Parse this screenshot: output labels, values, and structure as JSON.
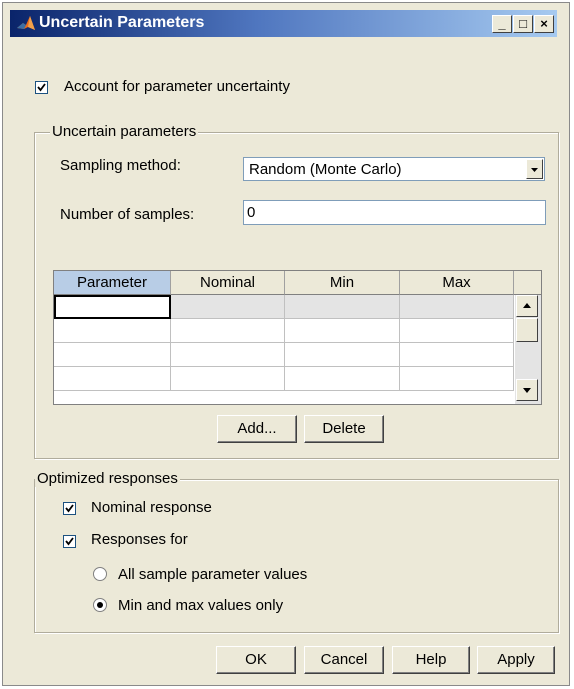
{
  "window": {
    "title": "Uncertain Parameters",
    "controls": {
      "minimize": "_",
      "maximize": "□",
      "close": "×"
    }
  },
  "account_uncertainty": {
    "label": "Account for parameter uncertainty",
    "checked": true
  },
  "uncertain_group": {
    "title": "Uncertain parameters",
    "sampling_label": "Sampling method:",
    "sampling_value": "Random (Monte Carlo)",
    "samples_label": "Number of samples:",
    "samples_value": "0",
    "table": {
      "columns": [
        "Parameter",
        "Nominal",
        "Min",
        "Max"
      ],
      "rows": [
        [
          "",
          "",
          "",
          ""
        ],
        [
          "",
          "",
          "",
          ""
        ],
        [
          "",
          "",
          "",
          ""
        ],
        [
          "",
          "",
          "",
          ""
        ]
      ]
    },
    "add_label": "Add...",
    "delete_label": "Delete"
  },
  "optimized_group": {
    "title": "Optimized responses",
    "nominal_label": "Nominal response",
    "nominal_checked": true,
    "responses_for_label": "Responses for",
    "responses_for_checked": true,
    "radio_all_label": "All sample parameter values",
    "radio_minmax_label": "Min and max values only",
    "selected_radio": "minmax"
  },
  "footer": {
    "ok": "OK",
    "cancel": "Cancel",
    "help": "Help",
    "apply": "Apply"
  },
  "colors": {
    "title_start": "#0a246a",
    "title_end": "#a6caf0",
    "dialog_bg": "#ece9d8",
    "header_selected": "#b8cde6"
  }
}
